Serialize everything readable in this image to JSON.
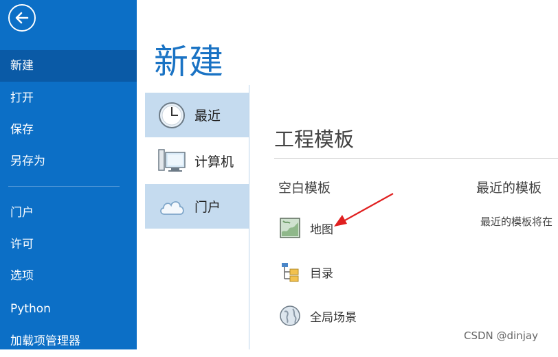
{
  "sidebar": {
    "items": [
      {
        "label": "新建"
      },
      {
        "label": "打开"
      },
      {
        "label": "保存"
      },
      {
        "label": "另存为"
      },
      {
        "label": "门户"
      },
      {
        "label": "许可"
      },
      {
        "label": "选项"
      },
      {
        "label": "Python"
      },
      {
        "label": "加载项管理器"
      }
    ]
  },
  "page": {
    "title": "新建"
  },
  "nav": {
    "items": [
      {
        "label": "最近",
        "icon": "clock-icon"
      },
      {
        "label": "计算机",
        "icon": "computer-icon"
      },
      {
        "label": "门户",
        "icon": "cloud-icon"
      }
    ]
  },
  "main": {
    "section_title": "工程模板",
    "blank_templates_heading": "空白模板",
    "recent_templates_heading": "最近的模板",
    "recent_templates_note": "最近的模板将在",
    "templates": [
      {
        "label": "地图",
        "icon": "map-icon"
      },
      {
        "label": "目录",
        "icon": "catalog-icon"
      },
      {
        "label": "全局场景",
        "icon": "globe-icon"
      }
    ]
  },
  "watermark": "CSDN @dinjay",
  "colors": {
    "sidebar": "#0c6fc6",
    "sidebar_selected": "#0a5aa6",
    "nav_selected": "#c5dbef",
    "title_blue": "#1a73c4",
    "annotation_arrow": "#e02020"
  }
}
